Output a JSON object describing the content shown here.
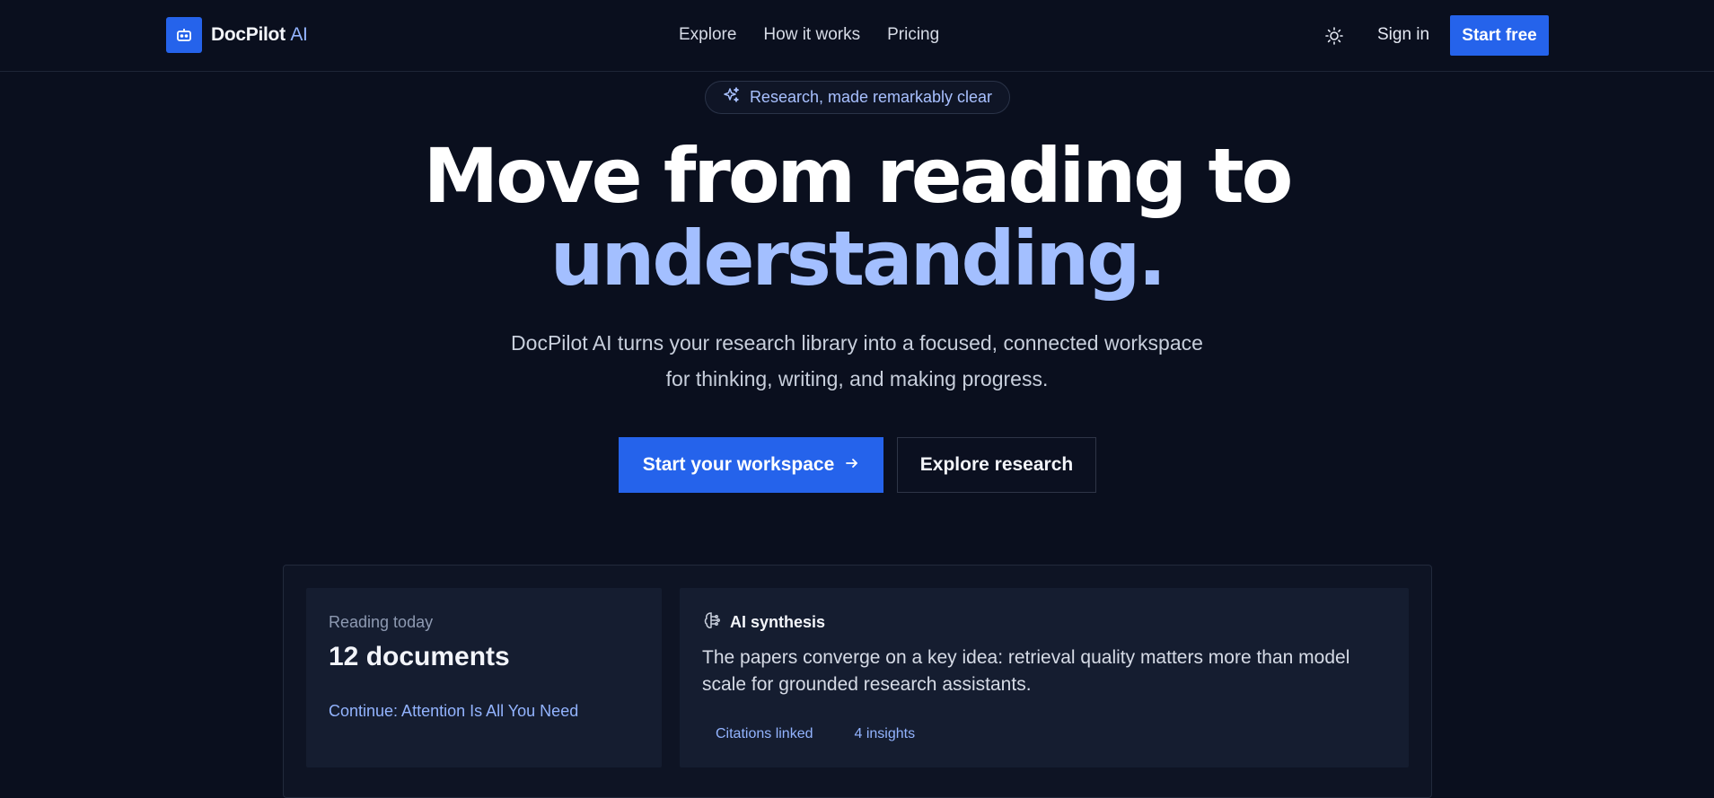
{
  "brand": {
    "name": "DocPilot",
    "suffix": "AI",
    "icon": "robot-icon",
    "color": "#2563eb"
  },
  "nav": {
    "items": [
      "Explore",
      "How it works",
      "Pricing"
    ]
  },
  "header": {
    "theme_icon": "sun-icon",
    "signin": "Sign in",
    "start_free": "Start free"
  },
  "hero": {
    "badge": "Research, made remarkably clear",
    "badge_icon": "sparkles-icon",
    "headline_line1": "Move from reading to",
    "headline_line2": "understanding.",
    "subtitle_line1": "DocPilot AI turns your research library into a focused, connected workspace",
    "subtitle_line2": "for thinking, writing, and making progress.",
    "cta_primary": "Start your workspace",
    "cta_primary_icon": "arrow-right-icon",
    "cta_secondary": "Explore research"
  },
  "dashboard": {
    "reading": {
      "label": "Reading today",
      "value": "12 documents",
      "continue": "Continue: Attention Is All You Need"
    },
    "ai": {
      "icon": "brain-icon",
      "title": "AI synthesis",
      "body": "The papers converge on a key idea: retrieval quality matters more than model scale for grounded research assistants.",
      "tags": [
        "Citations linked",
        "4 insights"
      ]
    }
  },
  "colors": {
    "background": "#0a0f1e",
    "accent": "#2563eb",
    "highlight": "#a3bfff",
    "card": "#151d30"
  }
}
